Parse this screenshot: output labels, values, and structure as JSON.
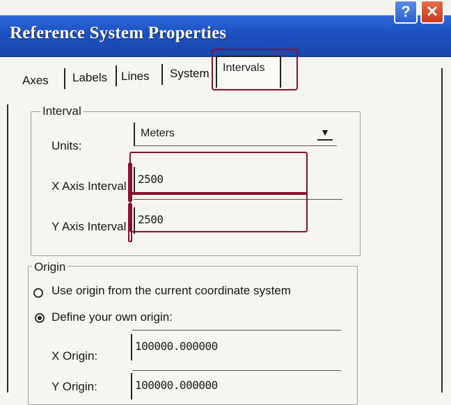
{
  "window": {
    "title": "Reference System Properties",
    "help_glyph": "?",
    "close_glyph": "✕"
  },
  "tabs": [
    {
      "label": "Axes"
    },
    {
      "label": "Labels"
    },
    {
      "label": "Lines"
    },
    {
      "label": "System"
    },
    {
      "label": "Intervals",
      "active": true
    }
  ],
  "interval": {
    "legend": "Interval",
    "units_label": "Units:",
    "units_value": "Meters",
    "x_label": "X Axis Interval",
    "x_value": "2500",
    "y_label": "Y Axis Interval",
    "y_value": "2500"
  },
  "origin": {
    "legend": "Origin",
    "option_current": "Use origin from the current coordinate system",
    "option_define": "Define your own origin:",
    "x_label": "X Origin:",
    "x_value": "100000.000000",
    "y_label": "Y Origin:",
    "y_value": "100000.000000"
  },
  "colors": {
    "titlebar": "#1d4fbf",
    "highlight": "#8a1030"
  }
}
